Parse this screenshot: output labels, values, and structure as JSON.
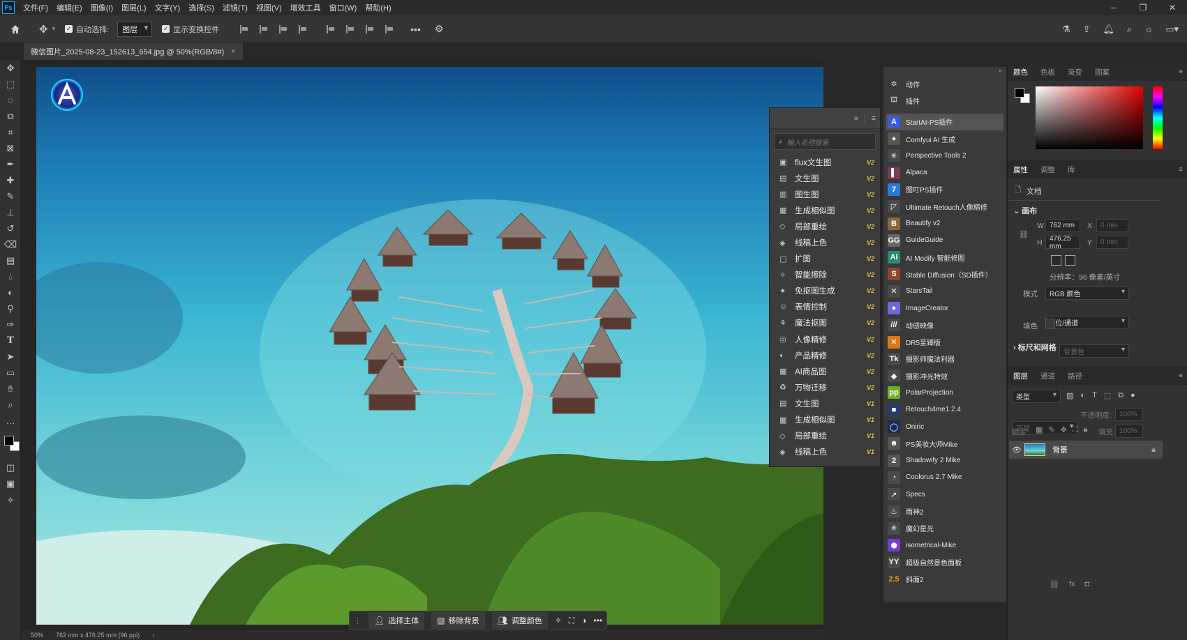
{
  "menubar": {
    "logo": "Ps",
    "items": [
      "文件(F)",
      "编辑(E)",
      "图像(I)",
      "图层(L)",
      "文字(Y)",
      "选择(S)",
      "滤镜(T)",
      "视图(V)",
      "增效工具",
      "窗口(W)",
      "帮助(H)"
    ]
  },
  "options": {
    "auto_select_label": "自动选择:",
    "auto_select_value": "图层",
    "show_transform_label": "显示变换控件"
  },
  "document_tab": {
    "title": "微信图片_2025-08-23_152613_654.jpg @ 50%(RGB/8#)",
    "close": "×"
  },
  "status": {
    "zoom": "50%",
    "size": "762 mm x 476.25 mm (96 ppi)"
  },
  "context_bar": {
    "select_subject": "选择主体",
    "remove_bg": "移除背景",
    "adjust_color": "调整颜色"
  },
  "ai_panel": {
    "search_placeholder": "输入名称搜索",
    "items": [
      {
        "name": "flux文生图",
        "badge": "V2"
      },
      {
        "name": "文生图",
        "badge": "V2"
      },
      {
        "name": "图生图",
        "badge": "V2"
      },
      {
        "name": "生成相似图",
        "badge": "V2"
      },
      {
        "name": "局部重绘",
        "badge": "V2"
      },
      {
        "name": "线稿上色",
        "badge": "V2"
      },
      {
        "name": "扩图",
        "badge": "V2"
      },
      {
        "name": "智能擦除",
        "badge": "V2"
      },
      {
        "name": "免抠图生成",
        "badge": "V2"
      },
      {
        "name": "表情控制",
        "badge": "V2"
      },
      {
        "name": "魔法抠图",
        "badge": "V2"
      },
      {
        "name": "人像精修",
        "badge": "V2"
      },
      {
        "name": "产品精修",
        "badge": "V2"
      },
      {
        "name": "AI商品图",
        "badge": "V2"
      },
      {
        "name": "万物迁移",
        "badge": "V2"
      },
      {
        "name": "文生图",
        "badge": "V1"
      },
      {
        "name": "生成相似图",
        "badge": "V1"
      },
      {
        "name": "局部重绘",
        "badge": "V1"
      },
      {
        "name": "线稿上色",
        "badge": "V1"
      }
    ]
  },
  "plugins_panel": {
    "top_items": [
      "动作",
      "插件"
    ],
    "items": [
      {
        "name": "StartAI-PS插件",
        "icon": "A",
        "color": "#3a5bd9"
      },
      {
        "name": "Comfyui AI 生成",
        "icon": "✦",
        "color": "#555"
      },
      {
        "name": "Perspective Tools 2",
        "icon": "✳",
        "color": "#4a4a4a"
      },
      {
        "name": "Alpaca",
        "icon": "▌",
        "color": "#7a3a5a"
      },
      {
        "name": "图叮PS插件",
        "icon": "7",
        "color": "#2a7ad9"
      },
      {
        "name": "Ultimate Retouch人像精修",
        "icon": "◸",
        "color": "#4a4a4a"
      },
      {
        "name": "Beautify v2",
        "icon": "B",
        "color": "#8a6a3a"
      },
      {
        "name": "GuideGuide",
        "icon": "GG",
        "color": "#666"
      },
      {
        "name": "AI Modify 智能修图",
        "icon": "AI",
        "color": "#2a8a7a"
      },
      {
        "name": "Stable Diffusion（SD插件）",
        "icon": "S",
        "color": "#8a4a2a"
      },
      {
        "name": "StarsTail",
        "icon": "✕",
        "color": "#4a4a4a"
      },
      {
        "name": "ImageCreator",
        "icon": "●",
        "color": "#6a6ad9"
      },
      {
        "name": "动感映像",
        "icon": "///",
        "color": "#4a4a4a"
      },
      {
        "name": "DR5至臻版",
        "icon": "✕",
        "color": "#d97a1a"
      },
      {
        "name": "摄影师魔法利器",
        "icon": "Tk",
        "color": "#4a4a4a"
      },
      {
        "name": "摄影冲光特效",
        "icon": "◆",
        "color": "#4a4a4a"
      },
      {
        "name": "PolarProjection",
        "icon": "pp",
        "color": "#6ab02a"
      },
      {
        "name": "Retouch4me1.2.4",
        "icon": "■",
        "color": "#2a3a6a"
      },
      {
        "name": "Oniric",
        "icon": "◯",
        "color": "#1a2a5a"
      },
      {
        "name": "PS美妆大师Mike",
        "icon": "☻",
        "color": "#555"
      },
      {
        "name": "Shadowify 2 Mike",
        "icon": "2",
        "color": "#555"
      },
      {
        "name": "Coolorus 2.7 Mike",
        "icon": "◔",
        "color": "#4a4a4a"
      },
      {
        "name": "Specs",
        "icon": "➚",
        "color": "#4a4a4a"
      },
      {
        "name": "雨神2",
        "icon": "♨",
        "color": "#4a4a4a"
      },
      {
        "name": "魔幻星光",
        "icon": "✳",
        "color": "#4a4a4a"
      },
      {
        "name": "isometrical-Mike",
        "icon": "⬢",
        "color": "#7a3ad9"
      },
      {
        "name": "超级自然景色面板",
        "icon": "YY",
        "color": "#4a4a4a"
      },
      {
        "name": "斜面2",
        "icon": "2.5",
        "color": "#3a3a3a"
      }
    ]
  },
  "color_panel": {
    "tabs": [
      "颜色",
      "色板",
      "渐变",
      "图案"
    ]
  },
  "properties_panel": {
    "tabs": [
      "属性",
      "调整",
      "库"
    ],
    "doc_label": "文档",
    "canvas_section": "画布",
    "w_label": "W",
    "w_value": "762 mm",
    "h_label": "H",
    "h_value": "476.25 mm",
    "x_label": "X",
    "x_value": "0 mm",
    "y_label": "Y",
    "y_value": "0 mm",
    "resolution": "分辨率：96 像素/英寸",
    "mode_label": "模式",
    "mode_value": "RGB 颜色",
    "depth_value": "8 位/通道",
    "fill_label": "填色",
    "fill_value": "背景色",
    "rulers_section": "标尺和网格"
  },
  "layers_panel": {
    "tabs": [
      "图层",
      "通道",
      "路径"
    ],
    "kind_placeholder": "类型",
    "blend_mode": "正常",
    "opacity_label": "不透明度:",
    "opacity_value": "100%",
    "lock_label": "锁定:",
    "fill_label": "填充:",
    "fill_value": "100%",
    "layer_name": "背景"
  },
  "colors": {
    "accent": "#31a8ff",
    "badge": "#e8c23c"
  }
}
